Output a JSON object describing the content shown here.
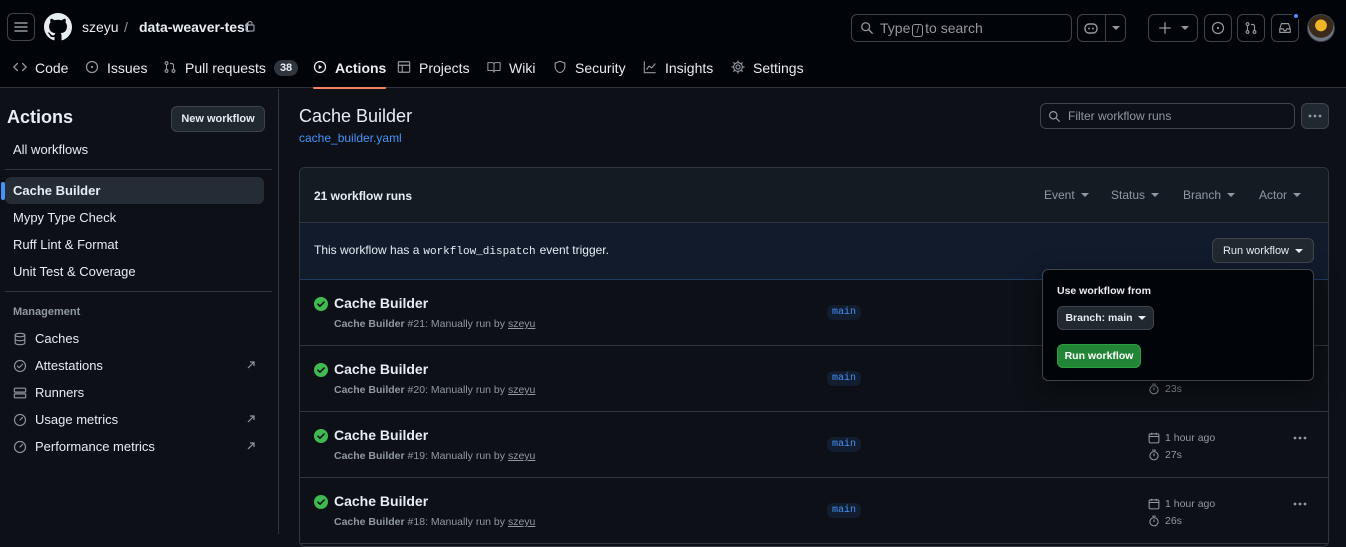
{
  "header": {
    "owner": "szeyu",
    "separator": "/",
    "repo": "data-weaver-test",
    "search_placeholder_before": "Type",
    "search_key": "/",
    "search_placeholder_after": "to search"
  },
  "tabs": [
    {
      "label": "Code",
      "icon": "code-icon"
    },
    {
      "label": "Issues",
      "icon": "issue-icon"
    },
    {
      "label": "Pull requests",
      "icon": "pull-request-icon",
      "count": "38"
    },
    {
      "label": "Actions",
      "icon": "play-icon",
      "active": true
    },
    {
      "label": "Projects",
      "icon": "table-icon"
    },
    {
      "label": "Wiki",
      "icon": "book-icon"
    },
    {
      "label": "Security",
      "icon": "shield-icon"
    },
    {
      "label": "Insights",
      "icon": "graph-icon"
    },
    {
      "label": "Settings",
      "icon": "gear-icon"
    }
  ],
  "sidebar": {
    "title": "Actions",
    "new_workflow": "New workflow",
    "all_workflows": "All workflows",
    "workflows": [
      "Cache Builder",
      "Mypy Type Check",
      "Ruff Lint & Format",
      "Unit Test & Coverage"
    ],
    "management_label": "Management",
    "management": [
      {
        "label": "Caches",
        "icon": "database-icon"
      },
      {
        "label": "Attestations",
        "icon": "verified-icon",
        "external": true
      },
      {
        "label": "Runners",
        "icon": "server-icon"
      },
      {
        "label": "Usage metrics",
        "icon": "meter-icon",
        "external": true
      },
      {
        "label": "Performance metrics",
        "icon": "meter-icon",
        "external": true
      }
    ]
  },
  "main": {
    "title": "Cache Builder",
    "file": "cache_builder.yaml",
    "filter_placeholder": "Filter workflow runs",
    "runs_count": "21 workflow runs",
    "filters": [
      "Event",
      "Status",
      "Branch",
      "Actor"
    ],
    "dispatch_before": "This workflow has a",
    "dispatch_code": "workflow_dispatch",
    "dispatch_after": "event trigger.",
    "run_workflow": "Run workflow",
    "runs": [
      {
        "title": "Cache Builder",
        "workflow": "Cache Builder",
        "number": "#21",
        "trigger": ": Manually run by",
        "user": "szeyu",
        "branch": "main",
        "when": "",
        "duration": ""
      },
      {
        "title": "Cache Builder",
        "workflow": "Cache Builder",
        "number": "#20",
        "trigger": ": Manually run by",
        "user": "szeyu",
        "branch": "main",
        "when": "",
        "duration": "23s"
      },
      {
        "title": "Cache Builder",
        "workflow": "Cache Builder",
        "number": "#19",
        "trigger": ": Manually run by",
        "user": "szeyu",
        "branch": "main",
        "when": "1 hour ago",
        "duration": "27s"
      },
      {
        "title": "Cache Builder",
        "workflow": "Cache Builder",
        "number": "#18",
        "trigger": ": Manually run by",
        "user": "szeyu",
        "branch": "main",
        "when": "1 hour ago",
        "duration": "26s"
      }
    ]
  },
  "popover": {
    "title": "Use workflow from",
    "branch_button": "Branch: main",
    "run_button": "Run workflow"
  },
  "colors": {
    "accent": "#4493f8",
    "success": "#3fb950",
    "tab_underline": "#f78166",
    "run_button": "#238636"
  }
}
